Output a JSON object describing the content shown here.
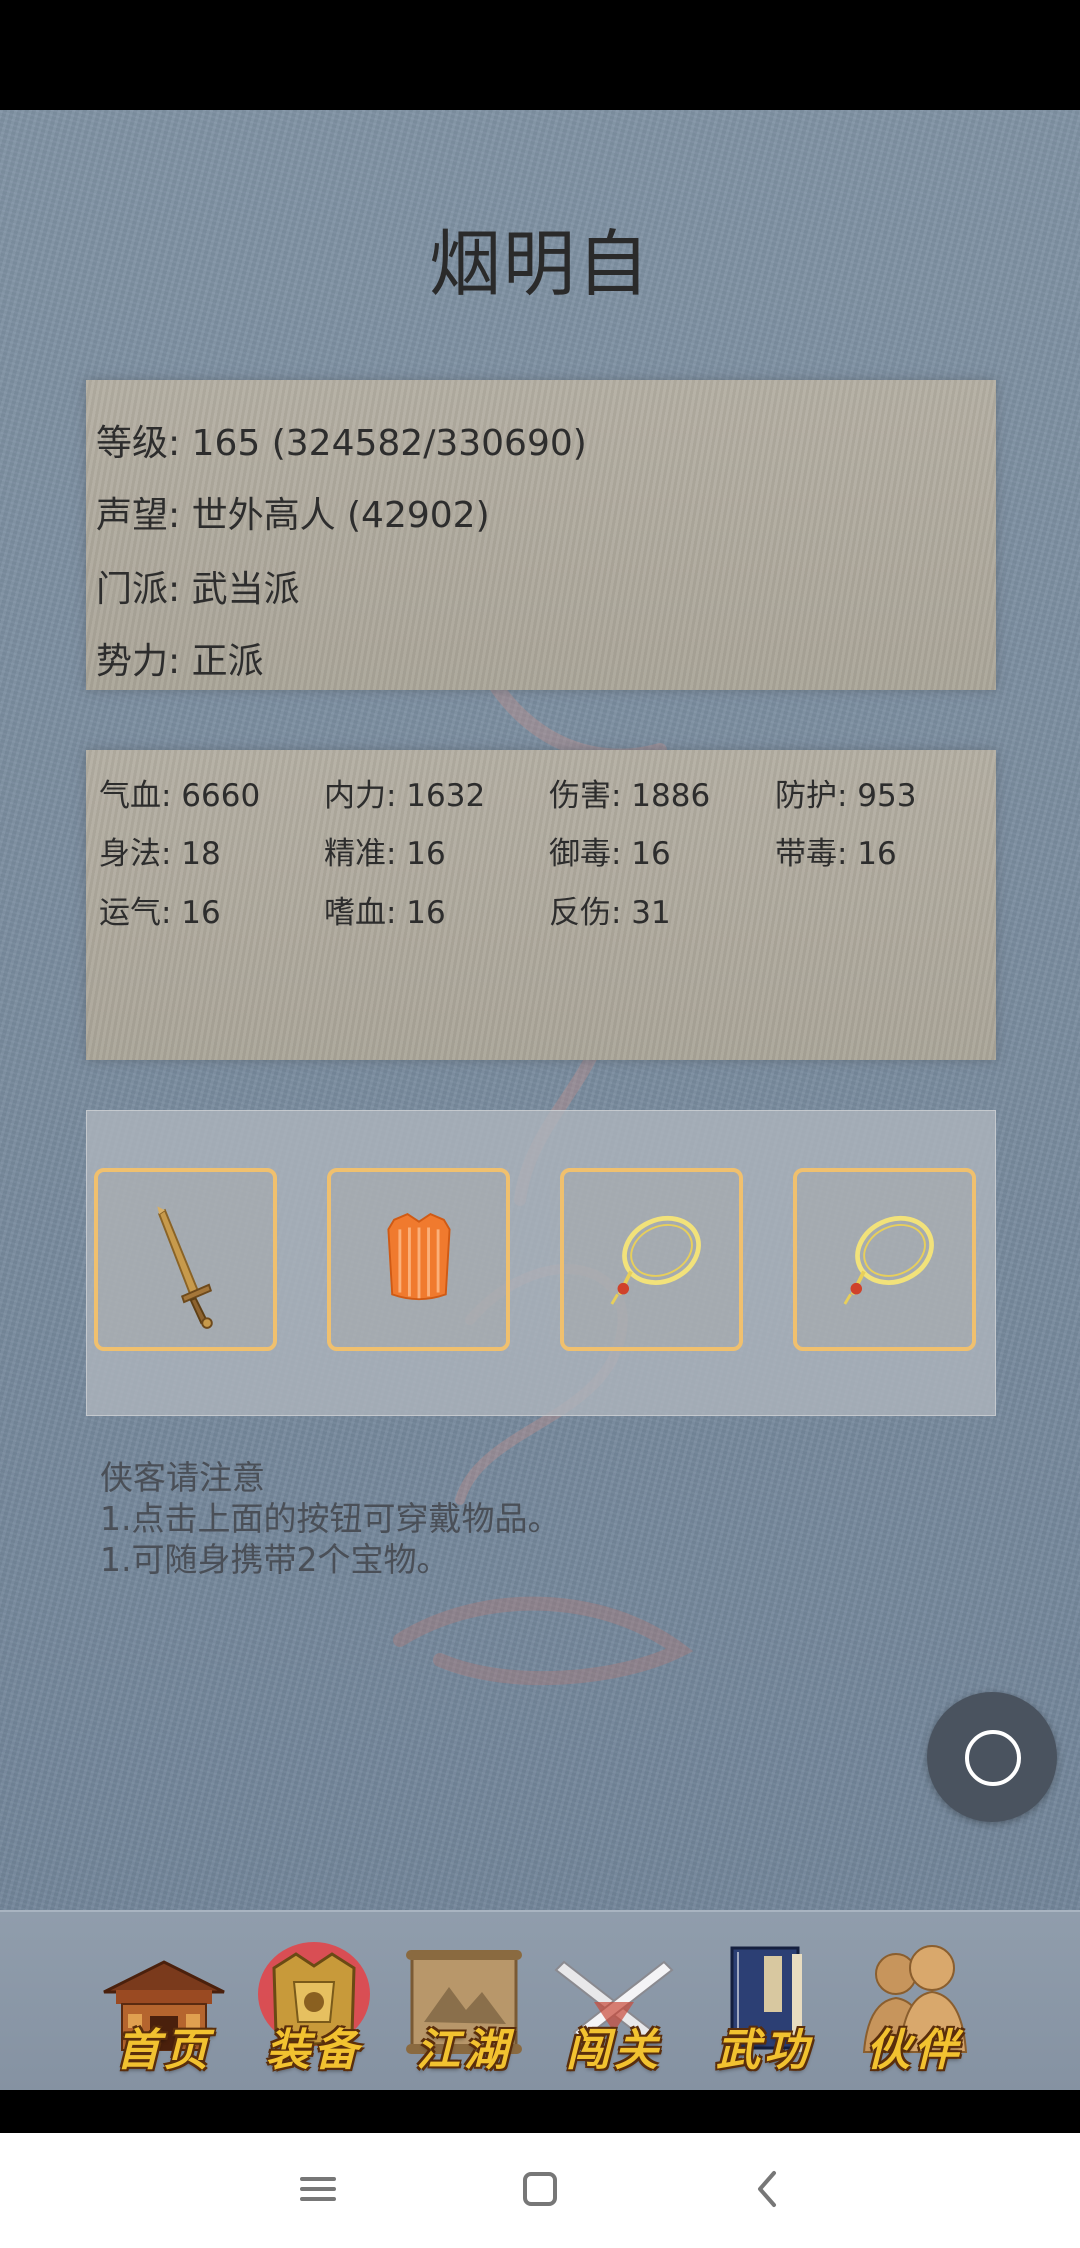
{
  "character": {
    "name": "烟明自"
  },
  "info": [
    {
      "key": "level",
      "text": "等级: 165 (324582/330690)"
    },
    {
      "key": "reputation",
      "text": "声望: 世外高人 (42902)"
    },
    {
      "key": "sect",
      "text": "门派: 武当派"
    },
    {
      "key": "faction",
      "text": "势力:  正派"
    }
  ],
  "stats": [
    {
      "key": "hp",
      "text": "气血: 6660"
    },
    {
      "key": "internal",
      "text": "内力: 1632"
    },
    {
      "key": "damage",
      "text": "伤害: 1886"
    },
    {
      "key": "defense",
      "text": "防护: 953"
    },
    {
      "key": "agility",
      "text": "身法: 18"
    },
    {
      "key": "accuracy",
      "text": "精准: 16"
    },
    {
      "key": "poison-resist",
      "text": "御毒: 16"
    },
    {
      "key": "poison",
      "text": "带毒: 16"
    },
    {
      "key": "luck",
      "text": "运气: 16"
    },
    {
      "key": "bloodthirst",
      "text": "嗜血: 16"
    },
    {
      "key": "reflect",
      "text": "反伤: 31"
    }
  ],
  "equipment": [
    {
      "item": "sword-icon"
    },
    {
      "item": "robe-icon"
    },
    {
      "item": "necklace-icon"
    },
    {
      "item": "necklace-icon"
    }
  ],
  "notice": {
    "title": "侠客请注意",
    "lines": [
      "1.点击上面的按钮可穿戴物品。",
      "1.可随身携带2个宝物。"
    ]
  },
  "nav": [
    {
      "label": "首页",
      "icon": "building-icon"
    },
    {
      "label": "装备",
      "icon": "armor-icon"
    },
    {
      "label": "江湖",
      "icon": "scroll-map-icon"
    },
    {
      "label": "闯关",
      "icon": "crossed-swords-icon"
    },
    {
      "label": "武功",
      "icon": "book-icon"
    },
    {
      "label": "伙伴",
      "icon": "companions-icon"
    }
  ],
  "colors": {
    "label_gold": "#f2c230",
    "slot_border": "#f0c06e"
  }
}
